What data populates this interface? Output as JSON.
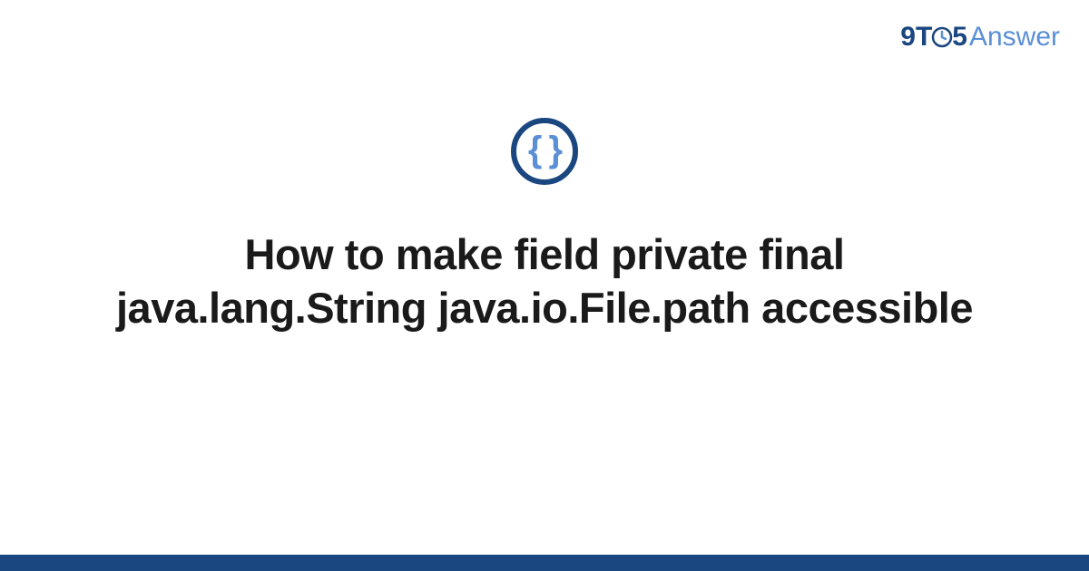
{
  "logo": {
    "part1": "9",
    "part2": "T",
    "part3": "5",
    "part4": "Answer"
  },
  "icon": {
    "name": "code-braces-icon",
    "glyph": "{ }"
  },
  "title": "How to make field private final java.lang.String java.io.File.path accessible",
  "colors": {
    "brand_dark": "#1a4780",
    "brand_light": "#5b8fd6"
  }
}
